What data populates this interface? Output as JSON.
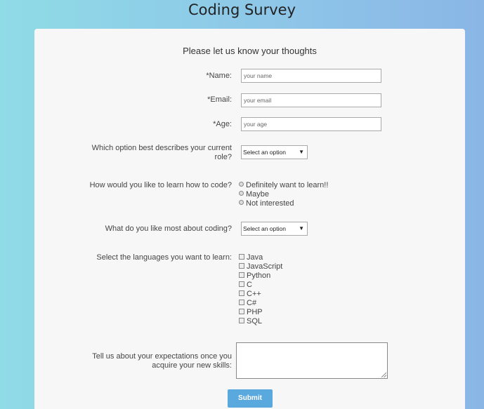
{
  "page_title": "Coding Survey",
  "form": {
    "subtitle": "Please let us know your thoughts",
    "name": {
      "label": "*Name:",
      "placeholder": "your name"
    },
    "email": {
      "label": "*Email:",
      "placeholder": "your email"
    },
    "age": {
      "label": "*Age:",
      "placeholder": "your age"
    },
    "role": {
      "label_line1": "Which option best describes your current",
      "label_line2": "role?",
      "selected": "Select an option"
    },
    "learn": {
      "label": "How would you like to learn how to code?",
      "options": [
        "Definitely want to learn!!",
        "Maybe",
        "Not interested"
      ]
    },
    "like_most": {
      "label": "What do you like most about coding?",
      "selected": "Select an option"
    },
    "languages": {
      "label": "Select the languages you want to learn:",
      "options": [
        "Java",
        "JavaScript",
        "Python",
        "C",
        "C++",
        "C#",
        "PHP",
        "SQL"
      ]
    },
    "expectations": {
      "label_line1": "Tell us about your expectations once you",
      "label_line2": "acquire your new skills:"
    },
    "submit_label": "Submit"
  }
}
